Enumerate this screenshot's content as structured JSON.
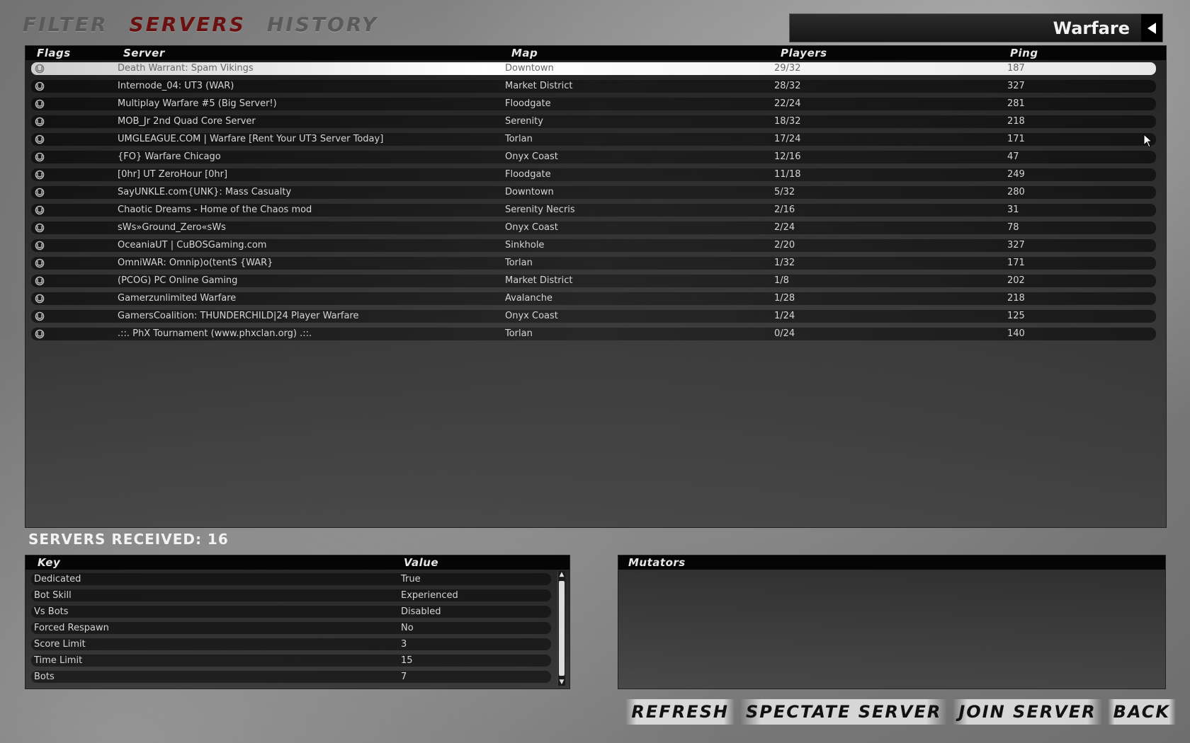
{
  "tabs": [
    {
      "label": "FILTER",
      "active": false
    },
    {
      "label": "SERVERS",
      "active": true
    },
    {
      "label": "HISTORY",
      "active": false
    }
  ],
  "gametype": {
    "label": "Warfare",
    "icon": "arrow-left-icon"
  },
  "server_list": {
    "headers": {
      "flags": "Flags",
      "server": "Server",
      "map": "Map",
      "players": "Players",
      "ping": "Ping"
    },
    "rows": [
      {
        "server": "Death Warrant: Spam Vikings",
        "map": "Downtown",
        "players": "29/32",
        "ping": "187",
        "selected": true
      },
      {
        "server": "Internode_04: UT3 (WAR)",
        "map": "Market District",
        "players": "28/32",
        "ping": "327"
      },
      {
        "server": "Multiplay Warfare #5 (Big Server!)",
        "map": "Floodgate",
        "players": "22/24",
        "ping": "281"
      },
      {
        "server": "MOB_Jr 2nd Quad Core Server",
        "map": "Serenity",
        "players": "18/32",
        "ping": "218"
      },
      {
        "server": "UMGLEAGUE.COM | Warfare [Rent Your UT3 Server Today]",
        "map": "Torlan",
        "players": "17/24",
        "ping": "171"
      },
      {
        "server": "{FO} Warfare Chicago",
        "map": "Onyx Coast",
        "players": "12/16",
        "ping": "47"
      },
      {
        "server": "[0hr] UT ZeroHour [0hr]",
        "map": "Floodgate",
        "players": "11/18",
        "ping": "249"
      },
      {
        "server": "SayUNKLE.com{UNK}: Mass Casualty",
        "map": "Downtown",
        "players": "5/32",
        "ping": "280"
      },
      {
        "server": "Chaotic Dreams - Home of the Chaos mod",
        "map": "Serenity Necris",
        "players": "2/16",
        "ping": "31"
      },
      {
        "server": "sWs»Ground_Zero«sWs",
        "map": "Onyx Coast",
        "players": "2/24",
        "ping": "78"
      },
      {
        "server": "OceaniaUT | CuBOSGaming.com",
        "map": "Sinkhole",
        "players": "2/20",
        "ping": "327"
      },
      {
        "server": "OmniWAR: Omnip)o(tentS {WAR}",
        "map": "Torlan",
        "players": "1/32",
        "ping": "171"
      },
      {
        "server": "(PCOG) PC Online Gaming",
        "map": "Market District",
        "players": "1/8",
        "ping": "202"
      },
      {
        "server": "Gamerzunlimited Warfare",
        "map": "Avalanche",
        "players": "1/28",
        "ping": "218"
      },
      {
        "server": "GamersCoalition: THUNDERCHILD|24 Player Warfare",
        "map": "Onyx Coast",
        "players": "1/24",
        "ping": "125"
      },
      {
        "server": ".::. PhX Tournament (www.phxclan.org) .::.",
        "map": "Torlan",
        "players": "0/24",
        "ping": "140"
      }
    ]
  },
  "servers_received": "SERVERS RECEIVED: 16",
  "info": {
    "headers": {
      "key": "Key",
      "value": "Value"
    },
    "rows": [
      {
        "key": "Dedicated",
        "value": "True"
      },
      {
        "key": "Bot Skill",
        "value": "Experienced"
      },
      {
        "key": "Vs Bots",
        "value": "Disabled"
      },
      {
        "key": "Forced Respawn",
        "value": "No"
      },
      {
        "key": "Score Limit",
        "value": "3"
      },
      {
        "key": "Time Limit",
        "value": "15"
      },
      {
        "key": "Bots",
        "value": "7"
      }
    ]
  },
  "mutators": {
    "header": "Mutators"
  },
  "actions": {
    "refresh": "REFRESH",
    "spectate": "SPECTATE SERVER",
    "join": "JOIN SERVER",
    "back": "BACK"
  },
  "colors": {
    "active_tab": "#6b1010",
    "inactive_tab": "#5a5a5a",
    "selected_row": "#ffffff"
  }
}
